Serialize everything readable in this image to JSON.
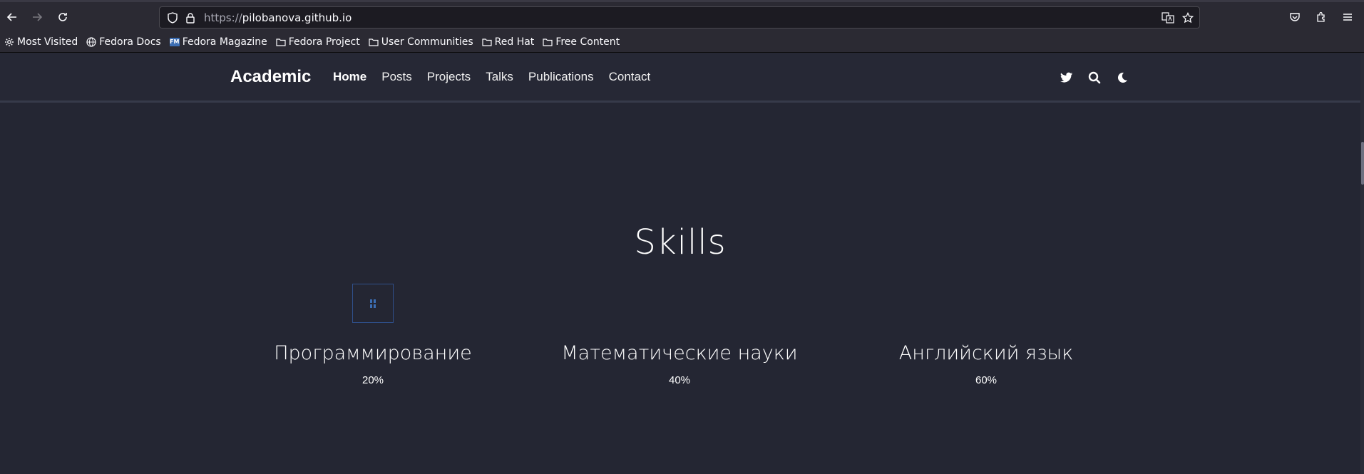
{
  "browser": {
    "url_protocol": "https://",
    "url_host": "pilobanova.github.io",
    "icons": [
      "back-arrow-icon",
      "forward-arrow-icon",
      "reload-icon",
      "shield-icon",
      "lock-icon",
      "translate-icon",
      "star-icon",
      "pocket-icon",
      "extensions-icon",
      "menu-icon"
    ]
  },
  "bookmarks": [
    {
      "label": "Most Visited",
      "icon": "gear-icon"
    },
    {
      "label": "Fedora Docs",
      "icon": "globe-icon"
    },
    {
      "label": "Fedora Magazine",
      "icon": "fm-icon",
      "badge": "FM"
    },
    {
      "label": "Fedora Project",
      "icon": "folder-icon"
    },
    {
      "label": "User Communities",
      "icon": "folder-icon"
    },
    {
      "label": "Red Hat",
      "icon": "folder-icon"
    },
    {
      "label": "Free Content",
      "icon": "folder-icon"
    }
  ],
  "site": {
    "brand": "Academic",
    "menu": [
      "Home",
      "Posts",
      "Projects",
      "Talks",
      "Publications",
      "Contact"
    ],
    "active": "Home",
    "icons": [
      "twitter-icon",
      "search-icon",
      "moon-icon"
    ]
  },
  "skills": {
    "title": "Skills",
    "items": [
      {
        "name": "Программирование",
        "percent": "20%"
      },
      {
        "name": "Математические науки",
        "percent": "40%"
      },
      {
        "name": "Английский язык",
        "percent": "60%"
      }
    ]
  },
  "colors": {
    "page_bg": "#242633",
    "nav_bg": "#262835",
    "browser_bg": "#2b2a33",
    "text": "#ffffff"
  }
}
